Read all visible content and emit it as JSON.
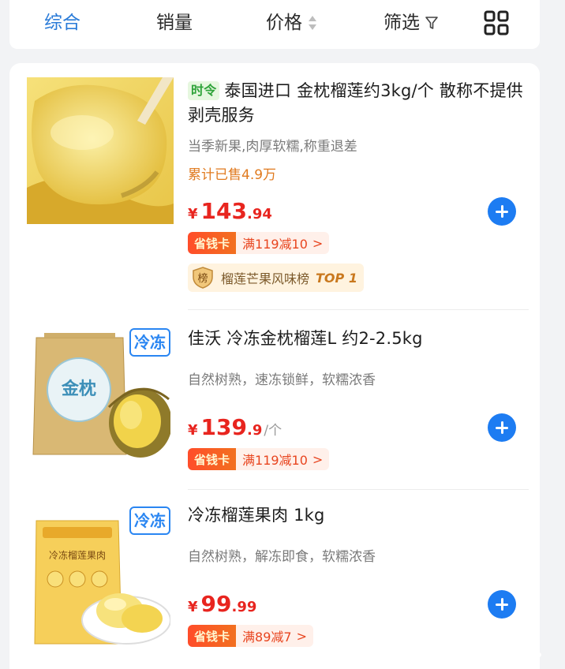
{
  "sort_bar": {
    "tabs": [
      {
        "label": "综合",
        "active": true
      },
      {
        "label": "销量"
      },
      {
        "label": "价格",
        "icon": "sort-updown-icon"
      },
      {
        "label": "筛选",
        "icon": "filter-funnel-icon"
      }
    ],
    "layout_icon": "grid-view-icon",
    "active_color": "#2a7bd8"
  },
  "products": [
    {
      "badge": "时令",
      "title": "泰国进口 金枕榴莲约3kg/个 散称不提供剥壳服务",
      "subtitle": "当季新果,肉厚软糯,称重退差",
      "sold": "累计已售4.9万",
      "price": {
        "currency": "¥",
        "int": "143",
        "dec": ".94",
        "unit": ""
      },
      "coupon": {
        "tag": "省钱卡",
        "deal": "满119减10",
        "arrow": ">"
      },
      "rank": {
        "icon": "榜",
        "label": "榴莲芒果风味榜",
        "top": "TOP 1"
      }
    },
    {
      "badge": "冷冻",
      "title": "佳沃 冷冻金枕榴莲L 约2-2.5kg",
      "subtitle": "自然树熟，速冻锁鲜，软糯浓香",
      "price": {
        "currency": "¥",
        "int": "139",
        "dec": ".9",
        "unit": "/个"
      },
      "coupon": {
        "tag": "省钱卡",
        "deal": "满119减10",
        "arrow": ">"
      },
      "package_text": "金枕"
    },
    {
      "badge": "冷冻",
      "title": "冷冻榴莲果肉 1kg",
      "subtitle": "自然树熟，解冻即食，软糯浓香",
      "price": {
        "currency": "¥",
        "int": "99",
        "dec": ".99",
        "unit": ""
      },
      "coupon": {
        "tag": "省钱卡",
        "deal": "满89减7",
        "arrow": ">"
      },
      "package_text": "冷冻榴莲果肉"
    }
  ],
  "colors": {
    "price": "#e8251f",
    "add_button": "#1d7cf2",
    "frozen_badge": "#2a86f2",
    "season_badge": "#2fa33a"
  }
}
